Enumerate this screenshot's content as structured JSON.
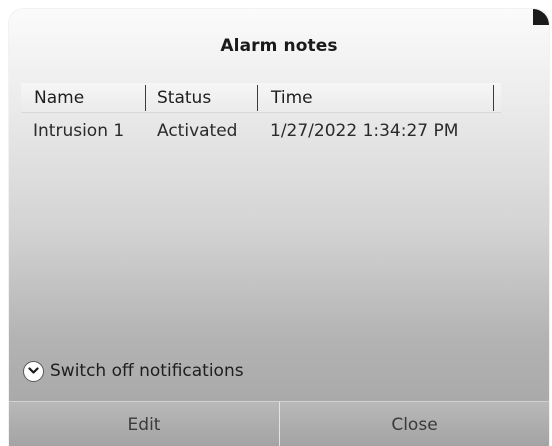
{
  "dialog": {
    "title": "Alarm notes"
  },
  "table": {
    "columns": [
      "Name",
      "Status",
      "Time"
    ],
    "rows": [
      {
        "name": "Intrusion 1",
        "status": "Activated",
        "time": "1/27/2022 1:34:27 PM"
      }
    ]
  },
  "toggle": {
    "label": "Switch off notifications",
    "icon": "chevron-down-icon"
  },
  "buttons": {
    "edit": "Edit",
    "close": "Close"
  }
}
